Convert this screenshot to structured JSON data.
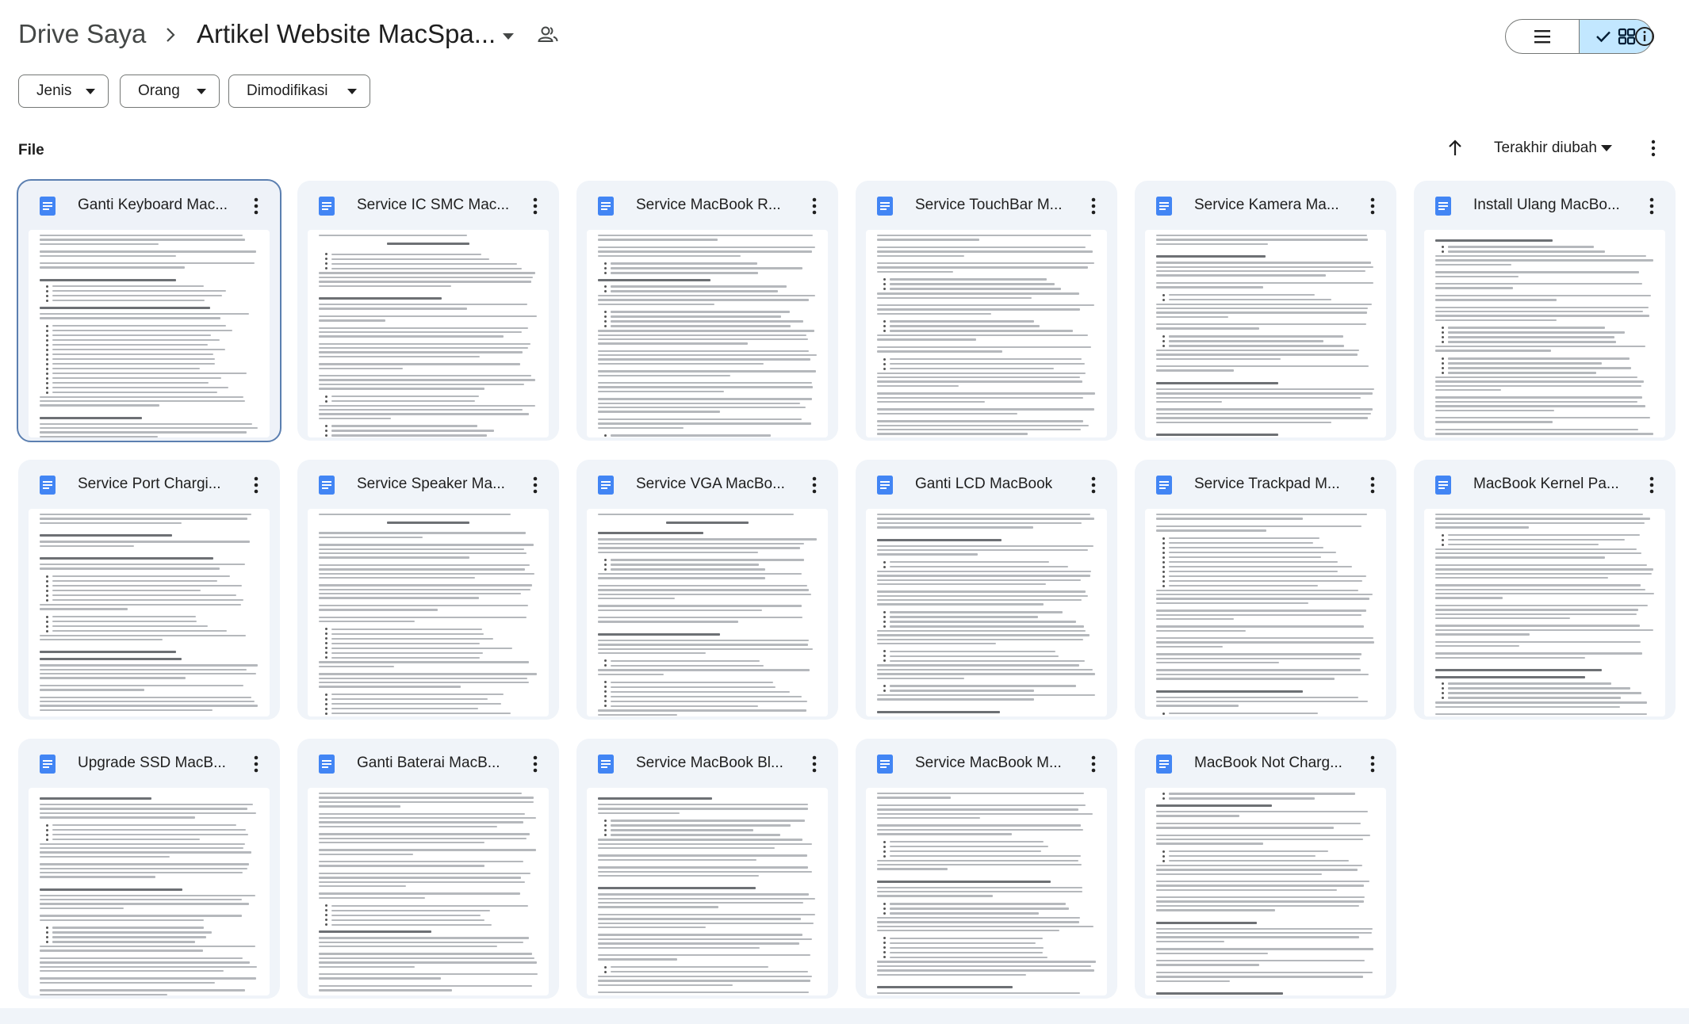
{
  "breadcrumb": {
    "root": "Drive Saya",
    "current": "Artikel Website MacSpa..."
  },
  "filters": [
    {
      "label": "Jenis"
    },
    {
      "label": "Orang"
    },
    {
      "label": "Dimodifikasi"
    }
  ],
  "section": {
    "title": "File",
    "sort_label": "Terakhir diubah"
  },
  "view": {
    "selected": "grid"
  },
  "files": [
    {
      "title": "Ganti Keyboard Mac...",
      "selected": true
    },
    {
      "title": "Service IC SMC Mac..."
    },
    {
      "title": "Service MacBook R..."
    },
    {
      "title": "Service TouchBar M..."
    },
    {
      "title": "Service Kamera Ma..."
    },
    {
      "title": "Install Ulang MacBo..."
    },
    {
      "title": "Service Port Chargi..."
    },
    {
      "title": "Service Speaker Ma..."
    },
    {
      "title": "Service VGA MacBo..."
    },
    {
      "title": "Ganti LCD MacBook"
    },
    {
      "title": "Service Trackpad M..."
    },
    {
      "title": "MacBook Kernel Pa..."
    },
    {
      "title": "Upgrade SSD MacB..."
    },
    {
      "title": "Ganti Baterai MacB..."
    },
    {
      "title": "Service MacBook Bl..."
    },
    {
      "title": "Service MacBook M..."
    },
    {
      "title": "MacBook Not Charg..."
    }
  ],
  "colors": {
    "doc_icon": "#4285f4",
    "toggle_active": "#c2e7ff"
  }
}
